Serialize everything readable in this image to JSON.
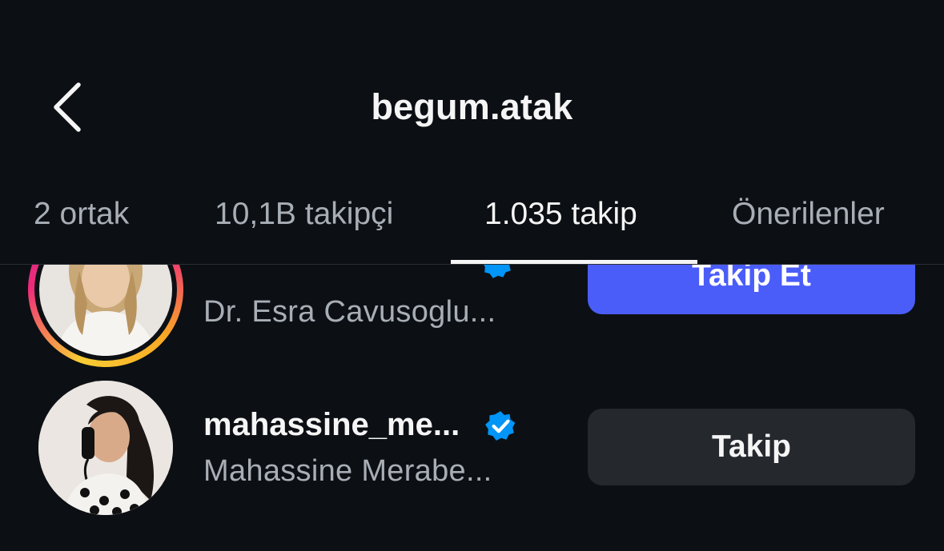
{
  "header": {
    "title": "begum.atak",
    "back_icon": "chevron-left-icon"
  },
  "tabs": [
    {
      "label": "2 ortak",
      "active": false
    },
    {
      "label": "10,1B takipçi",
      "active": false
    },
    {
      "label": "1.035 takip",
      "active": true
    },
    {
      "label": "Önerilenler",
      "active": false
    }
  ],
  "list": {
    "items": [
      {
        "username": "",
        "full_name": "Dr. Esra Cavusoglu...",
        "verified": true,
        "has_story_ring": true,
        "button_label": "Takip Et",
        "button_style": "primary"
      },
      {
        "username": "mahassine_me...",
        "full_name": "Mahassine Merabe...",
        "verified": true,
        "has_story_ring": false,
        "button_label": "Takip",
        "button_style": "secondary"
      }
    ]
  },
  "colors": {
    "background": "#0c1014",
    "primary_button": "#4a5df9",
    "secondary_button": "#25292e",
    "verified_badge": "#0095f6",
    "muted_text": "#a8aeb6"
  }
}
